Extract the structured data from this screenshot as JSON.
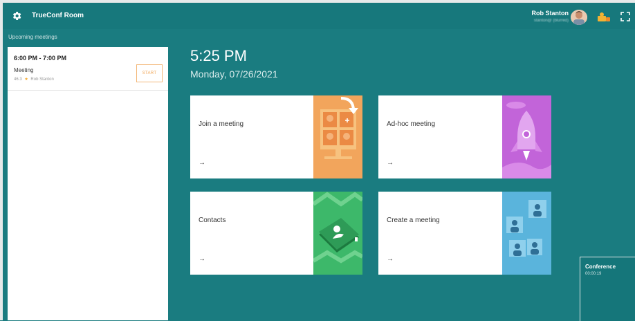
{
  "app": {
    "title": "TrueConf Room"
  },
  "user": {
    "name": "Rob Stanton",
    "email": "stanton@ (blurred)"
  },
  "sidebar": {
    "heading": "Upcoming meetings",
    "meetings": [
      {
        "time": "6:00 PM - 7:00 PM",
        "title": "Meeting",
        "id": "46.3",
        "owner": "Rob Stanton",
        "action": "START"
      }
    ]
  },
  "main": {
    "time": "5:25 PM",
    "date": "Monday, 07/26/2021",
    "tiles": [
      {
        "label": "Join a meeting",
        "arrow": "→",
        "color": "#f2a55c"
      },
      {
        "label": "Ad-hoc meeting",
        "arrow": "→",
        "color": "#c264d9"
      },
      {
        "label": "Contacts",
        "arrow": "→",
        "color": "#3db86a"
      },
      {
        "label": "Create a meeting",
        "arrow": "→",
        "color": "#5ab4dc"
      }
    ]
  },
  "conference": {
    "title": "Conference",
    "duration": "00:00:19"
  },
  "colors": {
    "background": "#1a7c80",
    "accent_orange": "#f0a24f"
  },
  "icons": [
    "gear-icon",
    "avatar",
    "status-icon",
    "fullscreen-icon",
    "star-icon",
    "arrow-right-icon"
  ]
}
